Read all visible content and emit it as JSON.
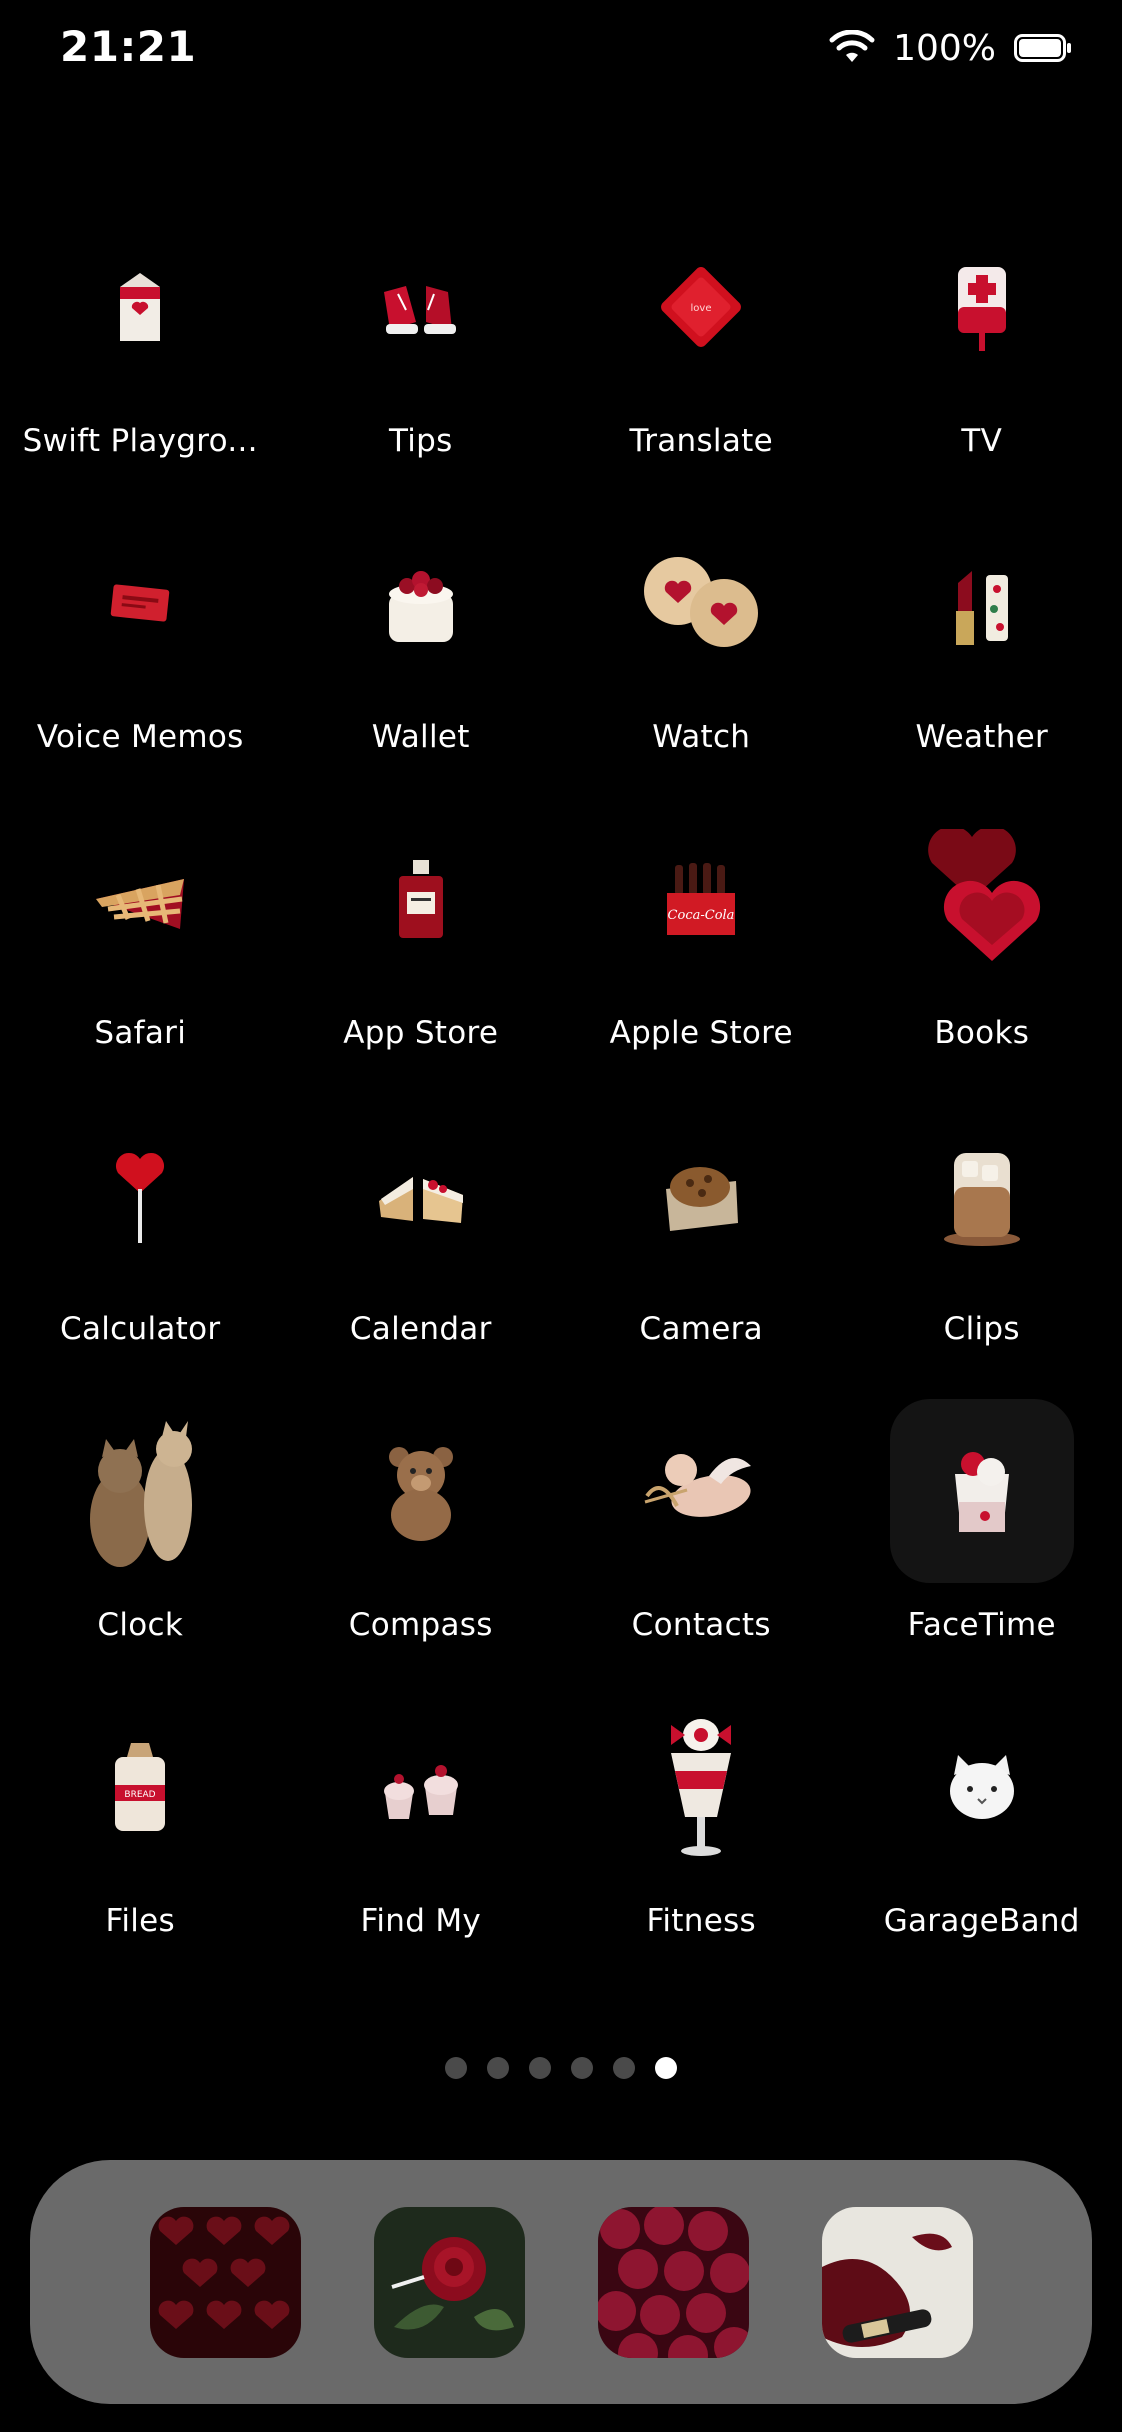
{
  "status_bar": {
    "time": "21:21",
    "battery_percent": "100%",
    "battery_level": 1.0,
    "wifi_icon": "wifi-icon",
    "battery_icon": "battery-icon"
  },
  "apps": [
    {
      "label": "Swift Playgro...",
      "icon": "milk-carton-icon"
    },
    {
      "label": "Tips",
      "icon": "red-sneakers-icon"
    },
    {
      "label": "Translate",
      "icon": "red-packet-icon"
    },
    {
      "label": "TV",
      "icon": "blood-bag-icon"
    },
    {
      "label": "Voice Memos",
      "icon": "red-ticket-icon"
    },
    {
      "label": "Wallet",
      "icon": "berry-cake-icon"
    },
    {
      "label": "Watch",
      "icon": "heart-cookies-icon"
    },
    {
      "label": "Weather",
      "icon": "lipstick-icon"
    },
    {
      "label": "Safari",
      "icon": "cherry-pie-icon"
    },
    {
      "label": "App Store",
      "icon": "perfume-bottle-icon"
    },
    {
      "label": "Apple Store",
      "icon": "cola-crate-icon"
    },
    {
      "label": "Books",
      "icon": "heart-compact-icon"
    },
    {
      "label": "Calculator",
      "icon": "heart-lollipop-icon"
    },
    {
      "label": "Calendar",
      "icon": "cheesecake-icon"
    },
    {
      "label": "Camera",
      "icon": "muffin-icon"
    },
    {
      "label": "Clips",
      "icon": "iced-coffee-icon"
    },
    {
      "label": "Clock",
      "icon": "cats-icon"
    },
    {
      "label": "Compass",
      "icon": "teddy-bear-icon"
    },
    {
      "label": "Contacts",
      "icon": "cupid-icon"
    },
    {
      "label": "FaceTime",
      "icon": "strawberry-cup-icon"
    },
    {
      "label": "Files",
      "icon": "bread-bag-icon"
    },
    {
      "label": "Find My",
      "icon": "cupcakes-icon"
    },
    {
      "label": "Fitness",
      "icon": "parfait-icon"
    },
    {
      "label": "GarageBand",
      "icon": "cat-plush-icon"
    }
  ],
  "page_indicator": {
    "total_pages": 6,
    "active_page": 6
  },
  "dock": [
    {
      "icon": "heart-chocolates-icon"
    },
    {
      "icon": "red-rose-icon"
    },
    {
      "icon": "raspberries-icon"
    },
    {
      "icon": "wine-spill-icon"
    }
  ]
}
